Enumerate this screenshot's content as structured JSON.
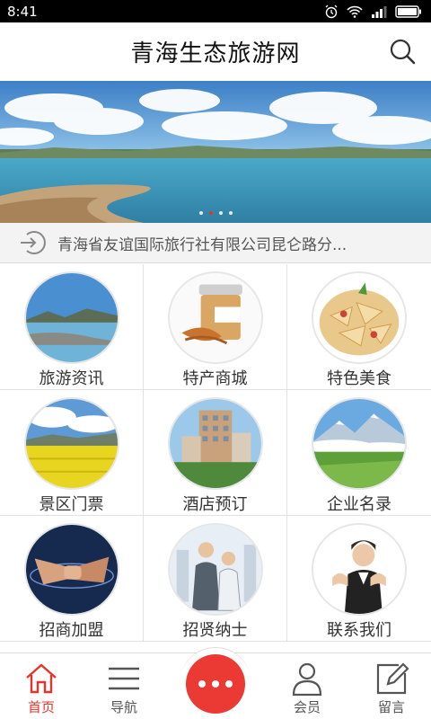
{
  "status_bar": {
    "time": "8:41",
    "icons": [
      "alarm-icon",
      "wifi-icon",
      "signal-icon",
      "battery-icon"
    ]
  },
  "header": {
    "title": "青海生态旅游网",
    "search_icon": "search-icon"
  },
  "banner": {
    "slide_count": 4,
    "active_index": 1
  },
  "notice": {
    "icon": "login-arrow-icon",
    "text": "青海省友谊国际旅行社有限公司昆仑路分..."
  },
  "grid": {
    "items": [
      {
        "label": "旅游资讯",
        "image": "lake-landscape"
      },
      {
        "label": "特产商城",
        "image": "cordyceps-jar"
      },
      {
        "label": "特色美食",
        "image": "noodle-dish"
      },
      {
        "label": "景区门票",
        "image": "rapeseed-field"
      },
      {
        "label": "酒店预订",
        "image": "hotel-building"
      },
      {
        "label": "企业名录",
        "image": "mountain-meadow"
      },
      {
        "label": "招商加盟",
        "image": "handshake"
      },
      {
        "label": "招贤纳士",
        "image": "business-people"
      },
      {
        "label": "联系我们",
        "image": "customer-service"
      }
    ]
  },
  "tabbar": {
    "items": [
      {
        "label": "首页",
        "icon": "home-icon",
        "active": true
      },
      {
        "label": "导航",
        "icon": "menu-icon",
        "active": false
      },
      {
        "label": "会员",
        "icon": "user-icon",
        "active": false
      },
      {
        "label": "留言",
        "icon": "edit-icon",
        "active": false
      }
    ],
    "center_icon": "more-icon"
  },
  "colors": {
    "accent": "#e5352b",
    "status_bg": "#000000",
    "notice_bg": "#f3f3f3"
  }
}
